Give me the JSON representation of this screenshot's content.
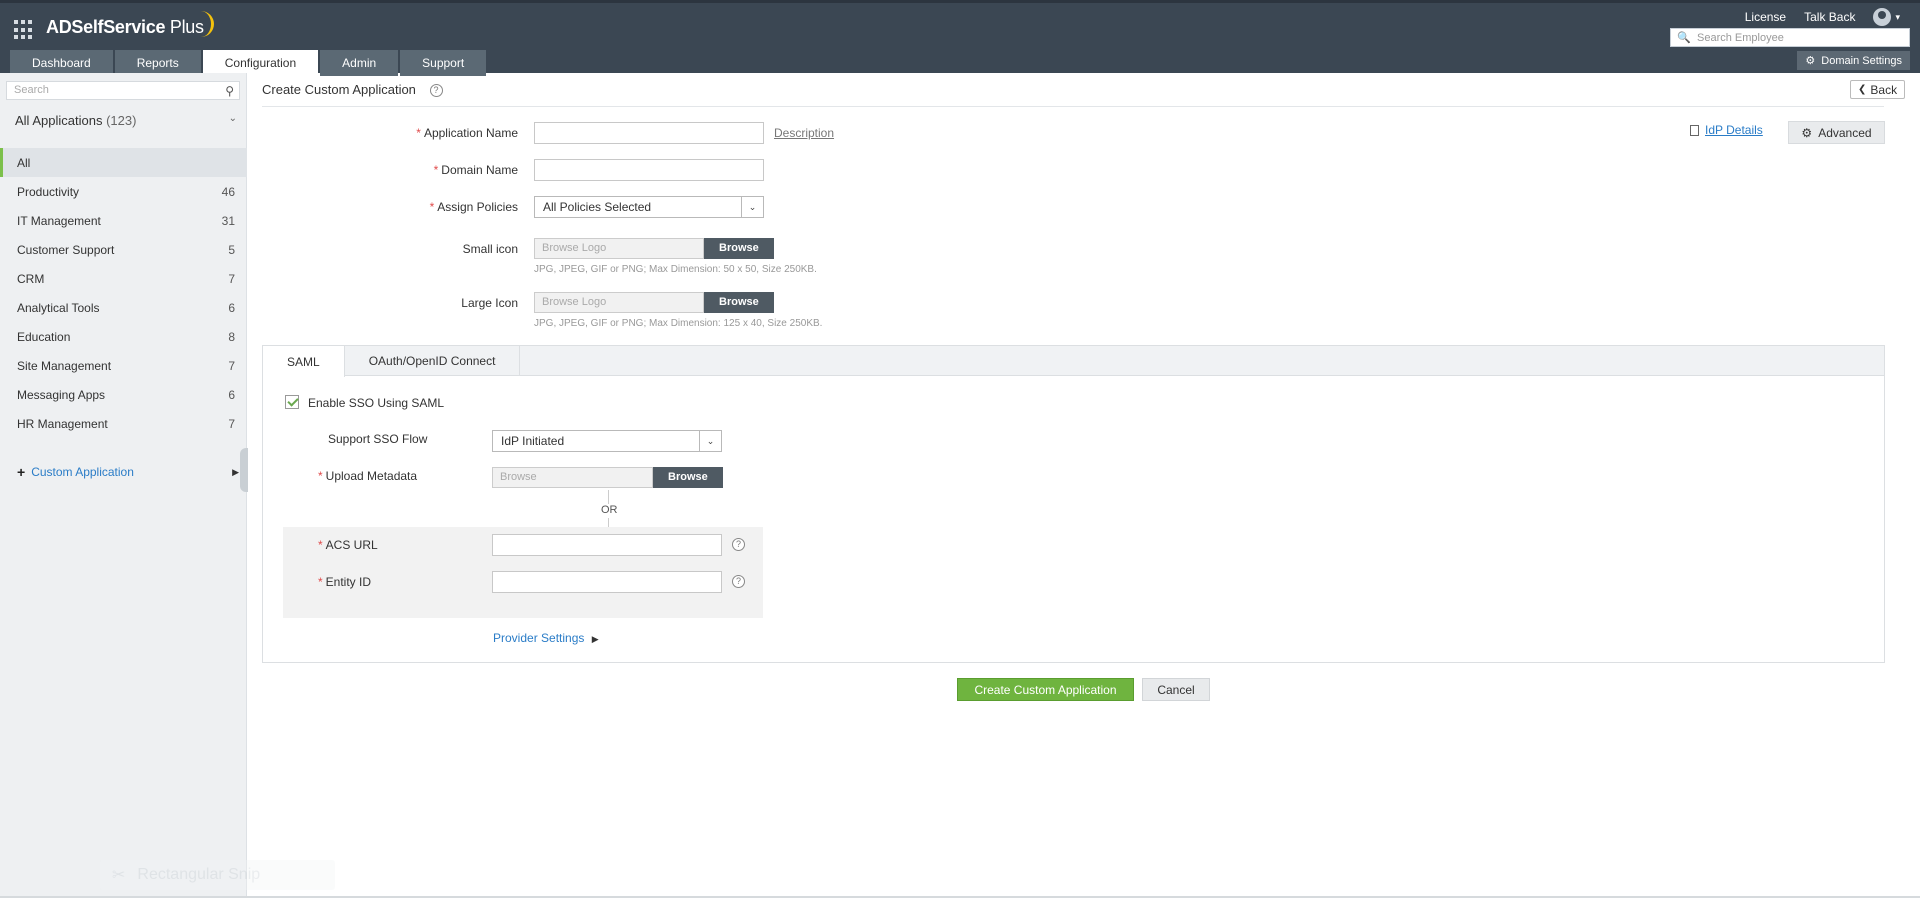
{
  "header": {
    "brand": "ADSelfService",
    "brand_plus": "Plus",
    "links": {
      "license": "License",
      "talk_back": "Talk Back"
    },
    "search_placeholder": "Search Employee",
    "domain_settings": "Domain Settings",
    "tabs": [
      "Dashboard",
      "Reports",
      "Configuration",
      "Admin",
      "Support"
    ],
    "active_tab": "Configuration"
  },
  "sidebar": {
    "search_placeholder": "Search",
    "all_apps_label": "All Applications",
    "all_apps_count": "(123)",
    "items": [
      {
        "label": "All",
        "count": ""
      },
      {
        "label": "Productivity",
        "count": "46"
      },
      {
        "label": "IT Management",
        "count": "31"
      },
      {
        "label": "Customer Support",
        "count": "5"
      },
      {
        "label": "CRM",
        "count": "7"
      },
      {
        "label": "Analytical Tools",
        "count": "6"
      },
      {
        "label": "Education",
        "count": "8"
      },
      {
        "label": "Site Management",
        "count": "7"
      },
      {
        "label": "Messaging Apps",
        "count": "6"
      },
      {
        "label": "HR Management",
        "count": "7"
      }
    ],
    "custom_application": "Custom Application"
  },
  "main": {
    "title": "Create Custom Application",
    "back": "Back",
    "idp_details": "IdP Details",
    "advanced": "Advanced",
    "fields": {
      "application_name": "Application Name",
      "description_link": "Description",
      "domain_name": "Domain Name",
      "assign_policies": "Assign Policies",
      "assign_policies_value": "All Policies Selected",
      "small_icon": "Small icon",
      "large_icon": "Large Icon",
      "browse_logo_placeholder": "Browse Logo",
      "browse_button": "Browse",
      "small_icon_hint": "JPG, JPEG, GIF or PNG; Max Dimension: 50 x 50, Size 250KB.",
      "large_icon_hint": "JPG, JPEG, GIF or PNG; Max Dimension: 125 x 40, Size 250KB."
    },
    "panel": {
      "tabs": [
        "SAML",
        "OAuth/OpenID Connect"
      ],
      "enable_sso": "Enable SSO Using SAML",
      "enable_sso_checked": true,
      "support_sso_flow": "Support SSO Flow",
      "sso_flow_value": "IdP Initiated",
      "upload_metadata": "Upload Metadata",
      "browse_placeholder": "Browse",
      "browse_button": "Browse",
      "or": "OR",
      "acs_url": "ACS URL",
      "entity_id": "Entity ID",
      "provider_settings": "Provider Settings"
    },
    "buttons": {
      "create": "Create Custom Application",
      "cancel": "Cancel"
    }
  },
  "ghost_overlay": "Rectangular Snip",
  "colors": {
    "header_bg": "#3b4753",
    "tab_bg": "#5b6974",
    "accent_green": "#6fb43f",
    "link_blue": "#2a7cc7",
    "required_red": "#e04b4b"
  }
}
